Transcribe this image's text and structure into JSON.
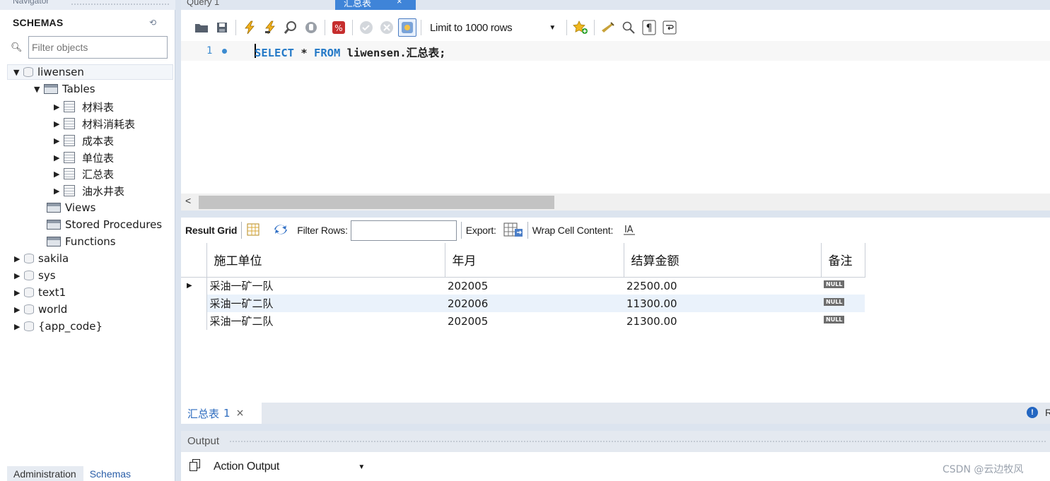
{
  "navigator": {
    "header": "Navigator",
    "schemas_title": "SCHEMAS",
    "filter_placeholder": "Filter objects",
    "root_schema": "liwensen",
    "tables_folder": "Tables",
    "tables": [
      "材料表",
      "材料消耗表",
      "成本表",
      "单位表",
      "汇总表",
      "油水井表"
    ],
    "folders": [
      "Views",
      "Stored Procedures",
      "Functions"
    ],
    "other_schemas": [
      "sakila",
      "sys",
      "text1",
      "world",
      "{app_code}"
    ],
    "bottom_tabs": [
      "Administration",
      "Schemas"
    ]
  },
  "editor_tabs": {
    "query1": "Query 1",
    "active": "汇总表",
    "close": "×"
  },
  "toolbar": {
    "limit": "Limit to 1000 rows"
  },
  "editor": {
    "line_number": "1",
    "kw_select": "SELECT",
    "star": " * ",
    "kw_from": "FROM",
    "table_ref": " liwensen.汇总表;"
  },
  "result_toolbar": {
    "result_grid": "Result Grid",
    "filter_rows": "Filter Rows:",
    "export": "Export:",
    "wrap": "Wrap Cell Content:"
  },
  "grid": {
    "columns": [
      "施工单位",
      "年月",
      "结算金额",
      "备注"
    ],
    "rows": [
      [
        "采油一矿一队",
        "202005",
        "22500.00",
        "NULL"
      ],
      [
        "采油一矿二队",
        "202006",
        "11300.00",
        "NULL"
      ],
      [
        "采油一矿二队",
        "202005",
        "21300.00",
        "NULL"
      ]
    ]
  },
  "result_tab": {
    "label": "汇总表",
    "count": "1",
    "close": "×"
  },
  "info_text": "R",
  "output": {
    "header": "Output",
    "selector": "Action Output"
  },
  "watermark": "CSDN @云边牧风"
}
